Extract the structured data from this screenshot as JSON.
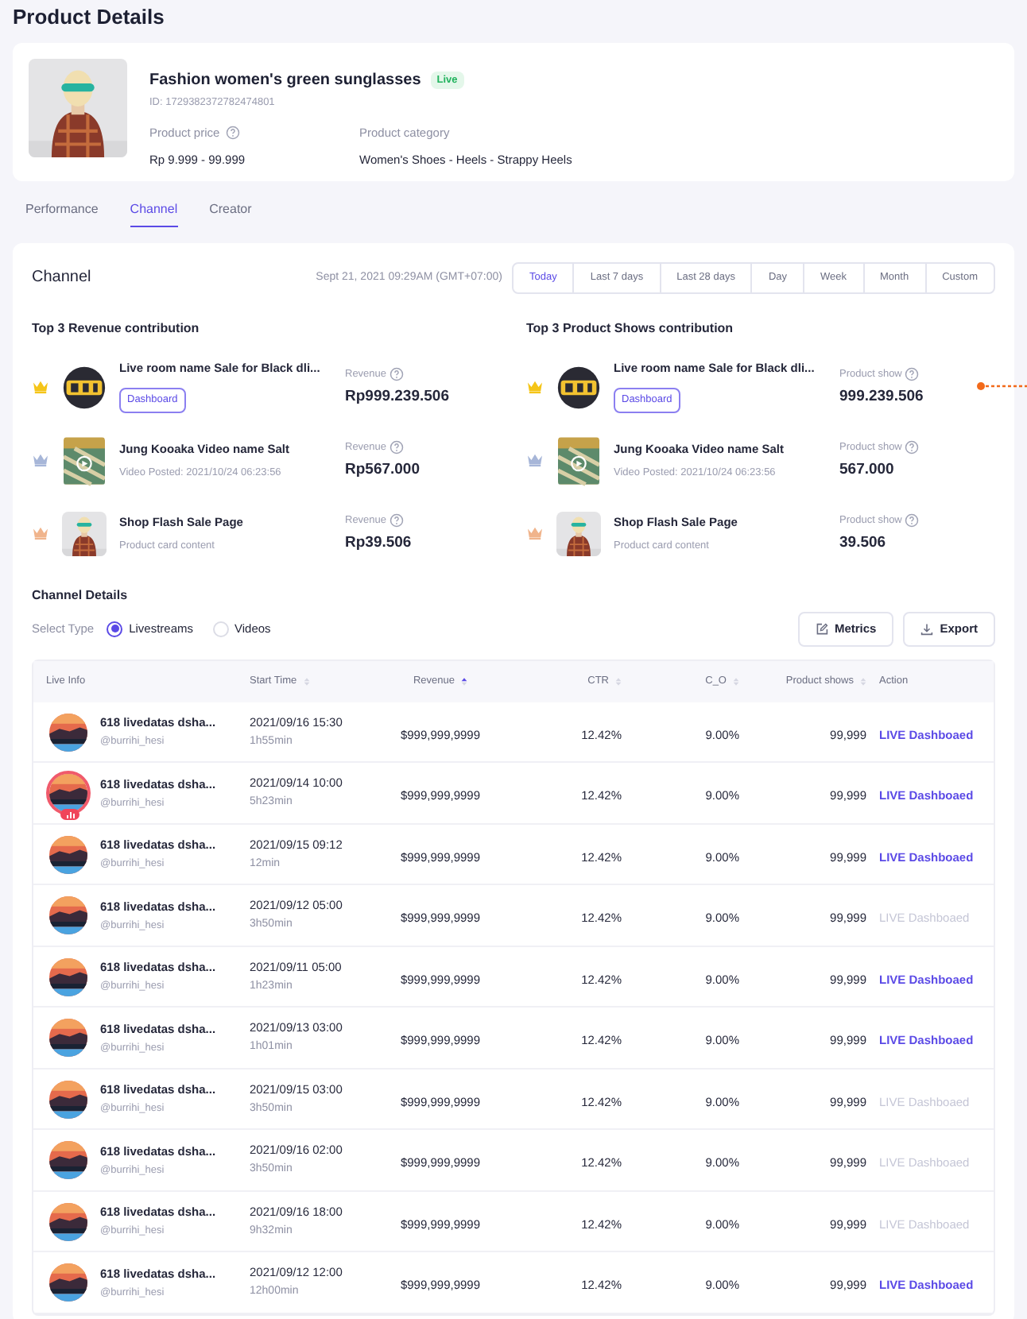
{
  "page_title": "Product Details",
  "product": {
    "name": "Fashion women's green sunglasses",
    "badge": "Live",
    "id": "ID: 1729382372782474801",
    "price_label": "Product price",
    "price": "Rp 9.999 - 99.999",
    "category_label": "Product category",
    "category": "Women's Shoes - Heels - Strappy Heels"
  },
  "tabs": [
    {
      "label": "Performance",
      "selected": false
    },
    {
      "label": "Channel",
      "selected": true
    },
    {
      "label": "Creator",
      "selected": false
    }
  ],
  "channel": {
    "title": "Channel",
    "timestamp": "Sept 21, 2021 09:29AM (GMT+07:00)",
    "ranges": [
      {
        "label": "Today",
        "selected": true
      },
      {
        "label": "Last 7 days",
        "selected": false
      },
      {
        "label": "Last 28 days",
        "selected": false
      },
      {
        "label": "Day",
        "selected": false
      },
      {
        "label": "Week",
        "selected": false
      },
      {
        "label": "Month",
        "selected": false
      },
      {
        "label": "Custom",
        "selected": false
      }
    ]
  },
  "top_lists": [
    {
      "title": "Top 3 Revenue contribution",
      "items": [
        {
          "kind": "live",
          "color": "#f5c518",
          "name": "Live room name Sale for Black dli...",
          "button": "Dashboard",
          "metric_label": "Revenue",
          "value": "Rp999.239.506"
        },
        {
          "kind": "video",
          "color": "#a7b6d8",
          "name": "Jung Kooaka Video name Salt",
          "subtitle": "Video Posted: 2021/10/24 06:23:56",
          "metric_label": "Revenue",
          "value": "Rp567.000"
        },
        {
          "kind": "page",
          "color": "#f0b48c",
          "name": "Shop Flash Sale Page",
          "subtitle": "Product card content",
          "metric_label": "Revenue",
          "value": "Rp39.506"
        }
      ]
    },
    {
      "title": "Top 3 Product Shows contribution",
      "items": [
        {
          "kind": "live",
          "color": "#f5c518",
          "name": "Live room name Sale for Black dli...",
          "button": "Dashboard",
          "metric_label": "Product show",
          "value": "999.239.506"
        },
        {
          "kind": "video",
          "color": "#a7b6d8",
          "name": "Jung Kooaka Video name Salt",
          "subtitle": "Video Posted: 2021/10/24 06:23:56",
          "metric_label": "Product show",
          "value": "567.000"
        },
        {
          "kind": "page",
          "color": "#f0b48c",
          "name": "Shop Flash Sale Page",
          "subtitle": "Product card content",
          "metric_label": "Product show",
          "value": "39.506"
        }
      ]
    }
  ],
  "details": {
    "title": "Channel Details",
    "select_label": "Select Type",
    "types": [
      {
        "label": "Livestreams",
        "selected": true
      },
      {
        "label": "Videos",
        "selected": false
      }
    ],
    "buttons": [
      {
        "kind": "metrics",
        "label": "Metrics"
      },
      {
        "kind": "export",
        "label": "Export"
      }
    ],
    "columns": [
      {
        "label": "Live Info",
        "sortable": false
      },
      {
        "label": "Start Time",
        "sortable": true,
        "sort_active": false
      },
      {
        "label": "Revenue",
        "sortable": true,
        "sort_active": true
      },
      {
        "label": "CTR",
        "sortable": true,
        "sort_active": false
      },
      {
        "label": "C_O",
        "sortable": true,
        "sort_active": false
      },
      {
        "label": "Product shows",
        "sortable": true,
        "sort_active": false
      },
      {
        "label": "Action",
        "sortable": false
      }
    ],
    "rows": [
      {
        "name": "618 livedatas dsha...",
        "handle": "@burrihi_hesi",
        "start": "2021/09/16 15:30",
        "duration": "1h55min",
        "revenue": "$999,999,9999",
        "ctr": "12.42%",
        "co": "9.00%",
        "shows": "99,999",
        "action": "LIVE Dashboaed",
        "disabled": false,
        "live": false
      },
      {
        "name": "618 livedatas dsha...",
        "handle": "@burrihi_hesi",
        "start": "2021/09/14 10:00",
        "duration": "5h23min",
        "revenue": "$999,999,9999",
        "ctr": "12.42%",
        "co": "9.00%",
        "shows": "99,999",
        "action": "LIVE Dashboaed",
        "disabled": false,
        "live": true
      },
      {
        "name": "618 livedatas dsha...",
        "handle": "@burrihi_hesi",
        "start": "2021/09/15 09:12",
        "duration": "12min",
        "revenue": "$999,999,9999",
        "ctr": "12.42%",
        "co": "9.00%",
        "shows": "99,999",
        "action": "LIVE Dashboaed",
        "disabled": false,
        "live": false
      },
      {
        "name": "618 livedatas dsha...",
        "handle": "@burrihi_hesi",
        "start": "2021/09/12 05:00",
        "duration": "3h50min",
        "revenue": "$999,999,9999",
        "ctr": "12.42%",
        "co": "9.00%",
        "shows": "99,999",
        "action": "LIVE Dashboaed",
        "disabled": true,
        "live": false
      },
      {
        "name": "618 livedatas dsha...",
        "handle": "@burrihi_hesi",
        "start": "2021/09/11 05:00",
        "duration": "1h23min",
        "revenue": "$999,999,9999",
        "ctr": "12.42%",
        "co": "9.00%",
        "shows": "99,999",
        "action": "LIVE Dashboaed",
        "disabled": false,
        "live": false
      },
      {
        "name": "618 livedatas dsha...",
        "handle": "@burrihi_hesi",
        "start": "2021/09/13 03:00",
        "duration": "1h01min",
        "revenue": "$999,999,9999",
        "ctr": "12.42%",
        "co": "9.00%",
        "shows": "99,999",
        "action": "LIVE Dashboaed",
        "disabled": false,
        "live": false
      },
      {
        "name": "618 livedatas dsha...",
        "handle": "@burrihi_hesi",
        "start": "2021/09/15 03:00",
        "duration": "3h50min",
        "revenue": "$999,999,9999",
        "ctr": "12.42%",
        "co": "9.00%",
        "shows": "99,999",
        "action": "LIVE Dashboaed",
        "disabled": true,
        "live": false
      },
      {
        "name": "618 livedatas dsha...",
        "handle": "@burrihi_hesi",
        "start": "2021/09/16 02:00",
        "duration": "3h50min",
        "revenue": "$999,999,9999",
        "ctr": "12.42%",
        "co": "9.00%",
        "shows": "99,999",
        "action": "LIVE Dashboaed",
        "disabled": true,
        "live": false
      },
      {
        "name": "618 livedatas dsha...",
        "handle": "@burrihi_hesi",
        "start": "2021/09/16 18:00",
        "duration": "9h32min",
        "revenue": "$999,999,9999",
        "ctr": "12.42%",
        "co": "9.00%",
        "shows": "99,999",
        "action": "LIVE Dashboaed",
        "disabled": true,
        "live": false
      },
      {
        "name": "618 livedatas dsha...",
        "handle": "@burrihi_hesi",
        "start": "2021/09/12 12:00",
        "duration": "12h00min",
        "revenue": "$999,999,9999",
        "ctr": "12.42%",
        "co": "9.00%",
        "shows": "99,999",
        "action": "LIVE Dashboaed",
        "disabled": false,
        "live": false
      }
    ]
  }
}
